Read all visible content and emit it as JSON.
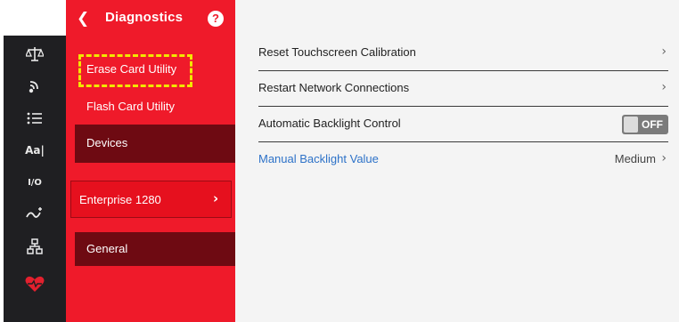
{
  "rail": {
    "icons": [
      {
        "name": "scale-icon",
        "glyph": "⚖"
      },
      {
        "name": "wireless-icon",
        "glyph": ""
      },
      {
        "name": "list-icon",
        "glyph": "☰"
      },
      {
        "name": "font-icon",
        "glyph": "Aa|"
      },
      {
        "name": "io-icon",
        "glyph": "I/O"
      },
      {
        "name": "signal-icon",
        "glyph": ""
      },
      {
        "name": "network-icon",
        "glyph": ""
      },
      {
        "name": "heart-monitor-icon",
        "glyph": "♥"
      }
    ],
    "accent": "#e3202e"
  },
  "menu": {
    "back_glyph": "❮",
    "title": "Diagnostics",
    "help_glyph": "?",
    "erase_label": "Erase Card Utility",
    "flash_label": "Flash Card Utility",
    "devices_label": "Devices",
    "enterprise_label": "Enterprise 1280",
    "enterprise_chevron": "›",
    "general_label": "General",
    "color": "#ef1a2a"
  },
  "content": {
    "rows": [
      {
        "label": "Reset Touchscreen Calibration",
        "chevron": "›"
      },
      {
        "label": "Restart Network Connections",
        "chevron": "›"
      },
      {
        "label": "Automatic Backlight Control",
        "toggle": "OFF"
      },
      {
        "label": "Manual Backlight Value",
        "value": "Medium",
        "chevron": "›"
      }
    ]
  }
}
